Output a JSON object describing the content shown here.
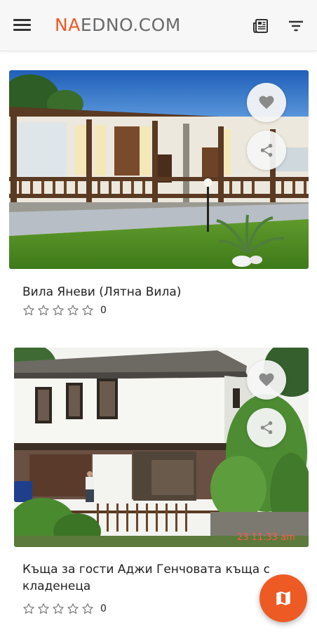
{
  "header": {
    "brand_accent": "NA",
    "brand_rest": "EDNO.COM",
    "icons": [
      "menu-icon",
      "news-icon",
      "filter-icon"
    ]
  },
  "listings": [
    {
      "title": "Вила Яневи (Лятна Вила)",
      "rating_count": "0",
      "stars_filled": 0,
      "stars_total": 5
    },
    {
      "title": "Къща за гости Аджи Генчовата къща с кладенеца",
      "rating_count": "0",
      "stars_filled": 0,
      "stars_total": 5,
      "photo_timestamp": "23 11:33 am"
    }
  ],
  "colors": {
    "accent": "#ee5a24",
    "header_bg": "#f7f7f7",
    "text": "#222222",
    "star_outline": "#7a7a7a"
  },
  "fab": {
    "icon": "map-icon"
  }
}
